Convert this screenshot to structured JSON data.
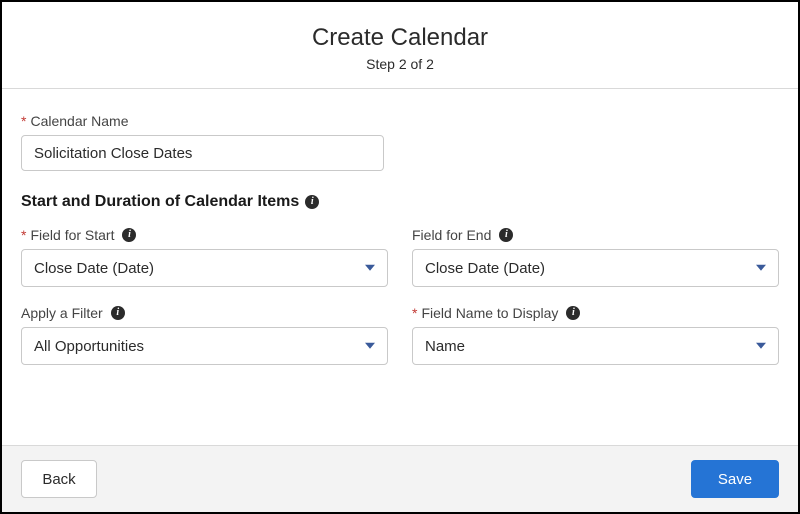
{
  "header": {
    "title": "Create Calendar",
    "subtitle": "Step 2 of 2"
  },
  "form": {
    "calendar_name": {
      "label": "Calendar Name",
      "value": "Solicitation Close Dates"
    },
    "section_heading": "Start and Duration of Calendar Items",
    "field_for_start": {
      "label": "Field for Start",
      "value": "Close Date (Date)"
    },
    "field_for_end": {
      "label": "Field for End",
      "value": "Close Date (Date)"
    },
    "apply_filter": {
      "label": "Apply a Filter",
      "value": "All Opportunities"
    },
    "field_name_display": {
      "label": "Field Name to Display",
      "value": "Name"
    }
  },
  "footer": {
    "back_label": "Back",
    "save_label": "Save"
  }
}
